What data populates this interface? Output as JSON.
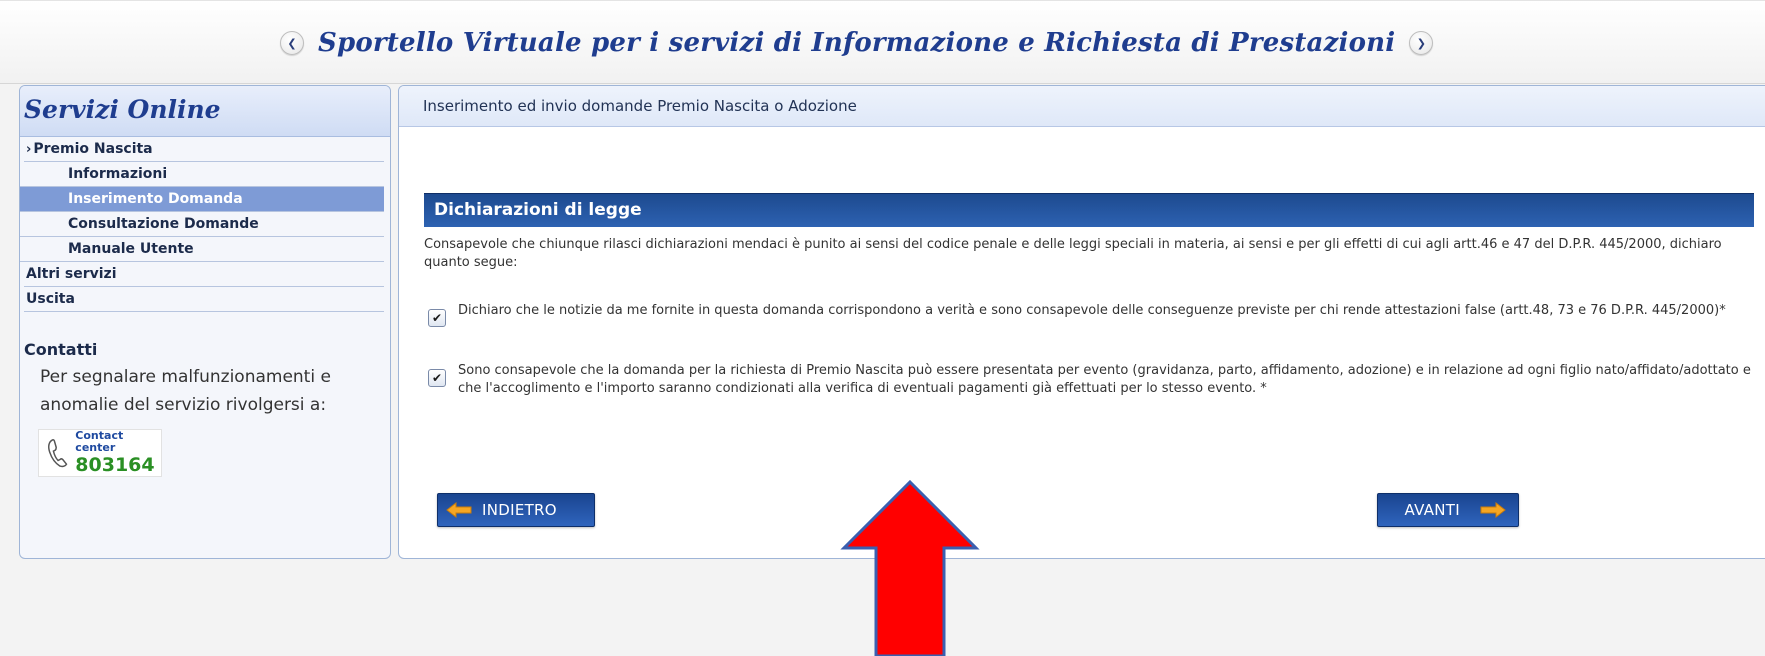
{
  "banner": {
    "title": "Sportello Virtuale per i servizi di Informazione e Richiesta di Prestazioni",
    "prev_icon": "chevron-left-icon",
    "next_icon": "chevron-right-icon"
  },
  "sidebar": {
    "title": "Servizi Online",
    "menu": [
      {
        "label": "Premio Nascita",
        "level": "top",
        "expanded": true
      },
      {
        "label": "Informazioni",
        "level": "sub"
      },
      {
        "label": "Inserimento Domanda",
        "level": "sub",
        "active": true
      },
      {
        "label": "Consultazione Domande",
        "level": "sub"
      },
      {
        "label": "Manuale Utente",
        "level": "sub"
      },
      {
        "label": "Altri servizi",
        "level": "top"
      },
      {
        "label": "Uscita",
        "level": "top"
      }
    ],
    "contacts": {
      "title": "Contatti",
      "text": "Per segnalare malfunzionamenti e anomalie del servizio rivolgersi a:",
      "contact_center_label": "Contact center",
      "phone_number": "803164",
      "icon": "phone-icon"
    }
  },
  "main": {
    "header": "Inserimento ed invio domande Premio Nascita o Adozione",
    "section_title": "Dichiarazioni di legge",
    "intro": "Consapevole che chiunque rilasci dichiarazioni mendaci è punito ai sensi del codice penale e delle leggi speciali in materia, ai sensi e per gli effetti di cui agli artt.46 e 47 del D.P.R. 445/2000, dichiaro quanto segue:",
    "declarations": [
      {
        "text": "Dichiaro che le notizie da me fornite in questa domanda corrispondono a verità e sono consapevole delle conseguenze previste per chi rende attestazioni false (artt.48, 73 e 76 D.P.R. 445/2000)*",
        "checked": true
      },
      {
        "text": "Sono consapevole che la domanda per la richiesta di Premio Nascita può essere presentata per evento (gravidanza, parto, affidamento, adozione) e in relazione ad ogni figlio nato/affidato/adottato e che l'accoglimento e l'importo saranno condizionati alla verifica di eventuali pagamenti già effettuati per lo stesso evento. *",
        "checked": true
      }
    ],
    "buttons": {
      "back_label": "INDIETRO",
      "next_label": "AVANTI"
    }
  },
  "colors": {
    "brand_blue": "#1f3d8f",
    "section_bar": "#1d4a8f",
    "active_menu": "#7e9bd6",
    "contact_green": "#2a8f24",
    "annotation_red": "#ff0000"
  }
}
